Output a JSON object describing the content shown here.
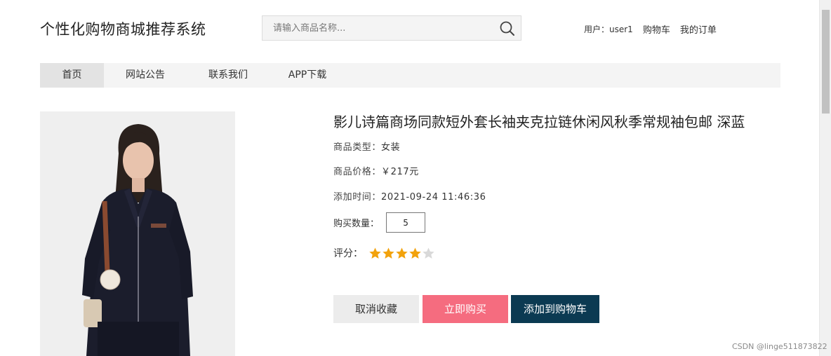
{
  "header": {
    "site_title": "个性化购物商城推荐系统",
    "search_placeholder": "请输入商品名称...",
    "user_label": "用户：user1",
    "cart_link": "购物车",
    "orders_link": "我的订单"
  },
  "nav": {
    "items": [
      {
        "label": "首页",
        "active": true
      },
      {
        "label": "网站公告",
        "active": false
      },
      {
        "label": "联系我们",
        "active": false
      },
      {
        "label": "APP下载",
        "active": false
      }
    ]
  },
  "product": {
    "title": "影儿诗篇商场同款短外套长袖夹克拉链休闲风秋季常规袖包邮 深蓝",
    "category_label": "商品类型：",
    "category_value": "女装",
    "price_label": "商品价格：",
    "price_value": "￥217元",
    "added_label": "添加时间：",
    "added_value": "2021-09-24 11:46:36",
    "quantity_label": "购买数量：",
    "quantity_value": "5",
    "rating_label": "评分：",
    "rating": 4,
    "rating_max": 5
  },
  "actions": {
    "unfavorite": "取消收藏",
    "buy_now": "立即购买",
    "add_to_cart": "添加到购物车"
  },
  "colors": {
    "buy_button": "#f56c7f",
    "cart_button": "#0b3a52",
    "star_filled": "#f2a20c",
    "star_empty": "#d9d9d9"
  },
  "watermark": "CSDN @linge511873822"
}
